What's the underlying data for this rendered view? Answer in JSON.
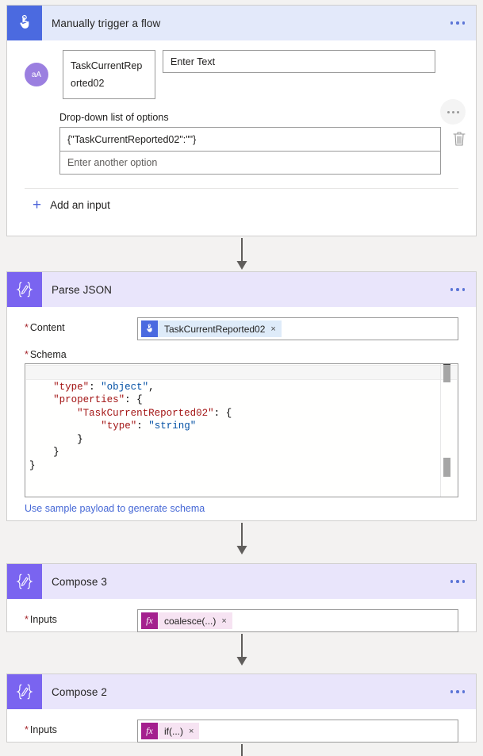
{
  "flow": {
    "trigger": {
      "title": "Manually trigger a flow",
      "icon": "hand-pointer-icon",
      "menu_label": "...",
      "input": {
        "avatar_icon": "text-input-icon",
        "avatar_label": "aA",
        "name_value": "TaskCurrentReported02",
        "value_placeholder": "Enter Text",
        "more_menu_label": "...",
        "options_label": "Drop-down list of options",
        "options": [
          {
            "value": "{\"TaskCurrentReported02\":\"\"}",
            "is_placeholder": false
          },
          {
            "value": "Enter another option",
            "is_placeholder": true
          }
        ],
        "delete_icon": "trash-icon"
      },
      "add_input_label": "Add an input",
      "add_input_icon": "plus-icon"
    },
    "actions": [
      {
        "title": "Parse JSON",
        "icon": "compose-braces-icon",
        "menu_label": "...",
        "content_label": "Content",
        "content_required": "*",
        "content_token": {
          "kind": "dynamic",
          "icon": "hand-pointer-icon",
          "text": "TaskCurrentReported02",
          "remove_label": "×"
        },
        "schema_label": "Schema",
        "schema_required": "*",
        "schema_code": "{\n    \"type\": \"object\",\n    \"properties\": {\n        \"TaskCurrentReported02\": {\n            \"type\": \"string\"\n        }\n    }\n}",
        "sample_link": "Use sample payload to generate schema"
      },
      {
        "title": "Compose 3",
        "icon": "compose-braces-icon",
        "menu_label": "...",
        "inputs_label": "Inputs",
        "inputs_required": "*",
        "inputs_token": {
          "kind": "expression",
          "icon": "fx-icon",
          "icon_label": "fx",
          "text": "coalesce(...)",
          "remove_label": "×"
        }
      },
      {
        "title": "Compose 2",
        "icon": "compose-braces-icon",
        "menu_label": "...",
        "inputs_label": "Inputs",
        "inputs_required": "*",
        "inputs_token": {
          "kind": "expression",
          "icon": "fx-icon",
          "icon_label": "fx",
          "text": "if(...)",
          "remove_label": "×"
        }
      }
    ]
  },
  "colors": {
    "trigger_accent": "#4b6ae0",
    "trigger_header_bg": "#e3e9fa",
    "action_accent": "#7a64f0",
    "action_header_bg": "#e9e5fb",
    "expression_accent": "#a4208e",
    "link": "#4668d6",
    "required_marker": "#a4262c",
    "page_bg": "#f3f2f1"
  }
}
